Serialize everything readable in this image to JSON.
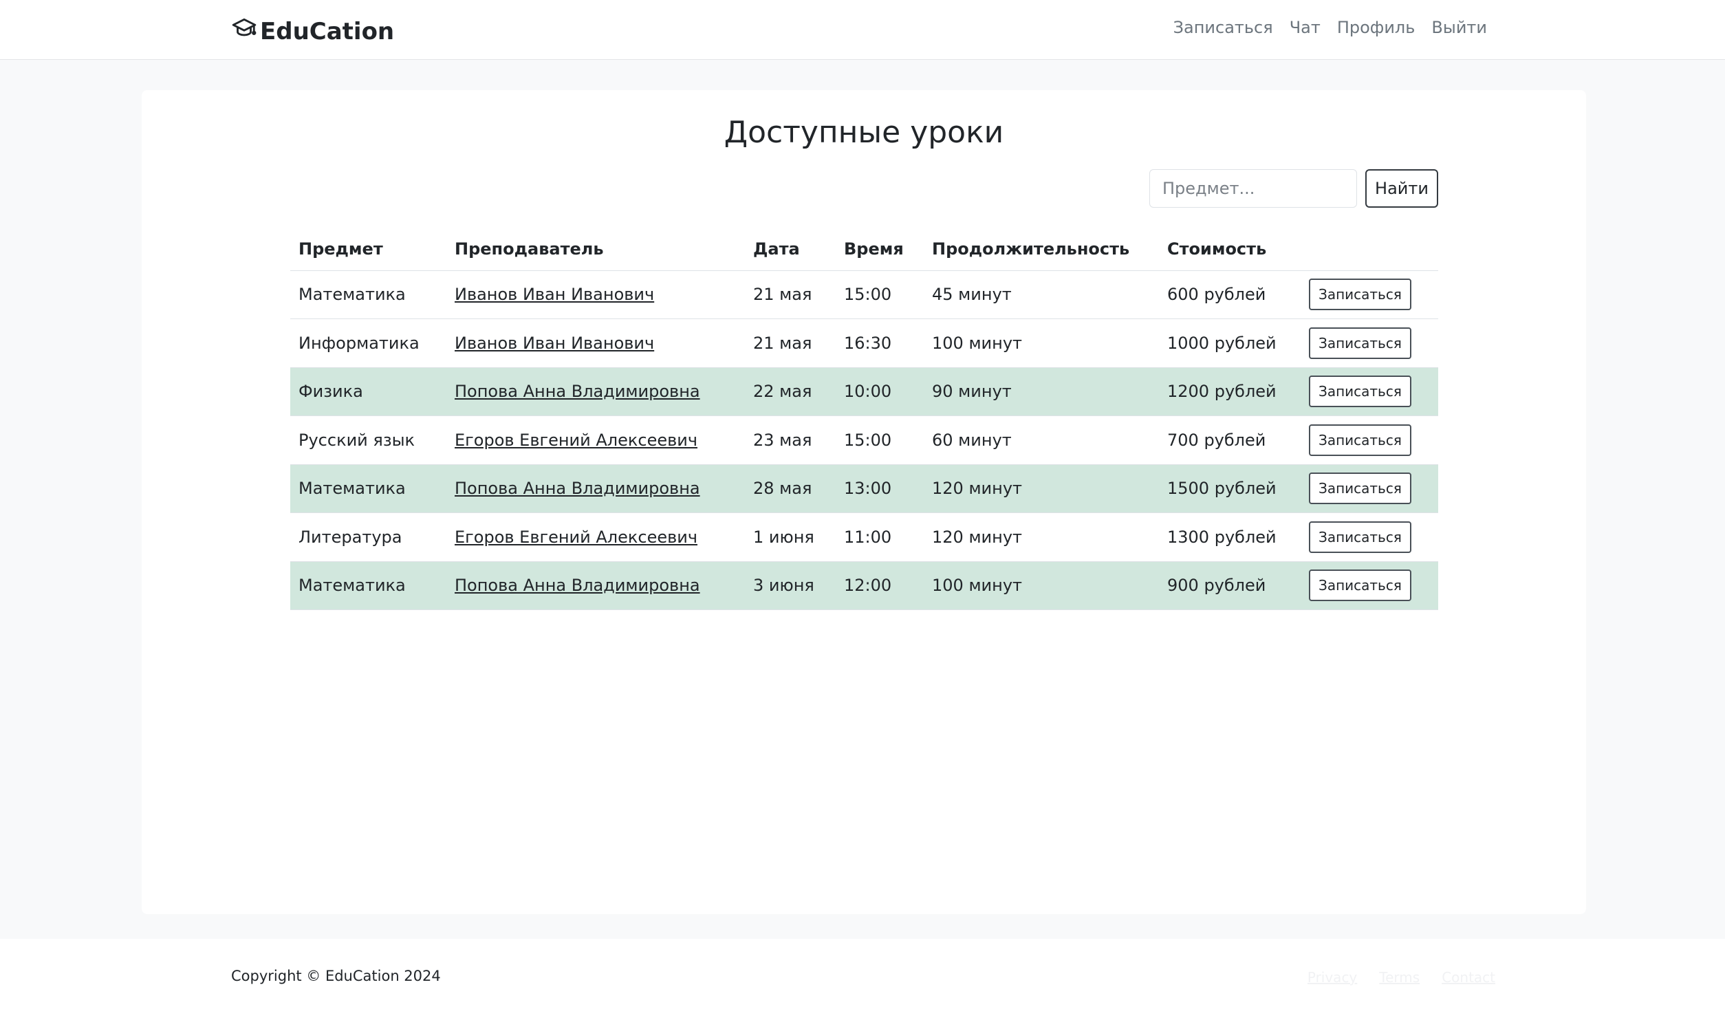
{
  "navbar": {
    "brand": "EduCation",
    "links": [
      {
        "label": "Записаться"
      },
      {
        "label": "Чат"
      },
      {
        "label": "Профиль"
      },
      {
        "label": "Выйти"
      }
    ]
  },
  "main": {
    "title": "Доступные уроки",
    "search": {
      "placeholder": "Предмет...",
      "button_label": "Найти"
    },
    "table": {
      "headers": [
        "Предмет",
        "Преподаватель",
        "Дата",
        "Время",
        "Продолжительность",
        "Стоимость"
      ],
      "rows": [
        {
          "subject": "Математика",
          "teacher": "Иванов Иван Иванович",
          "date": "21 мая",
          "time": "15:00",
          "duration": "45 минут",
          "price": "600 рублей",
          "action": "Записаться",
          "highlighted": false
        },
        {
          "subject": "Информатика",
          "teacher": "Иванов Иван Иванович",
          "date": "21 мая",
          "time": "16:30",
          "duration": "100 минут",
          "price": "1000 рублей",
          "action": "Записаться",
          "highlighted": false
        },
        {
          "subject": "Физика",
          "teacher": "Попова Анна Владимировна",
          "date": "22 мая",
          "time": "10:00",
          "duration": "90 минут",
          "price": "1200 рублей",
          "action": "Записаться",
          "highlighted": true
        },
        {
          "subject": "Русский язык",
          "teacher": "Егоров Евгений Алексеевич",
          "date": "23 мая",
          "time": "15:00",
          "duration": "60 минут",
          "price": "700 рублей",
          "action": "Записаться",
          "highlighted": false
        },
        {
          "subject": "Математика",
          "teacher": "Попова Анна Владимировна",
          "date": "28 мая",
          "time": "13:00",
          "duration": "120 минут",
          "price": "1500 рублей",
          "action": "Записаться",
          "highlighted": true
        },
        {
          "subject": "Литература",
          "teacher": "Егоров Евгений Алексеевич",
          "date": "1 июня",
          "time": "11:00",
          "duration": "120 минут",
          "price": "1300 рублей",
          "action": "Записаться",
          "highlighted": false
        },
        {
          "subject": "Математика",
          "teacher": "Попова Анна Владимировна",
          "date": "3 июня",
          "time": "12:00",
          "duration": "100 минут",
          "price": "900 рублей",
          "action": "Записаться",
          "highlighted": true
        }
      ]
    }
  },
  "footer": {
    "copyright": "Copyright © EduCation 2024",
    "links": [
      {
        "label": "Privacy"
      },
      {
        "label": "Terms"
      },
      {
        "label": "Contact"
      }
    ]
  },
  "colors": {
    "highlight_row": "#d1e7dd",
    "page_background": "#f8f9fa",
    "nav_link": "#6c757d"
  },
  "icons": {
    "brand": "graduation-cap-icon"
  }
}
